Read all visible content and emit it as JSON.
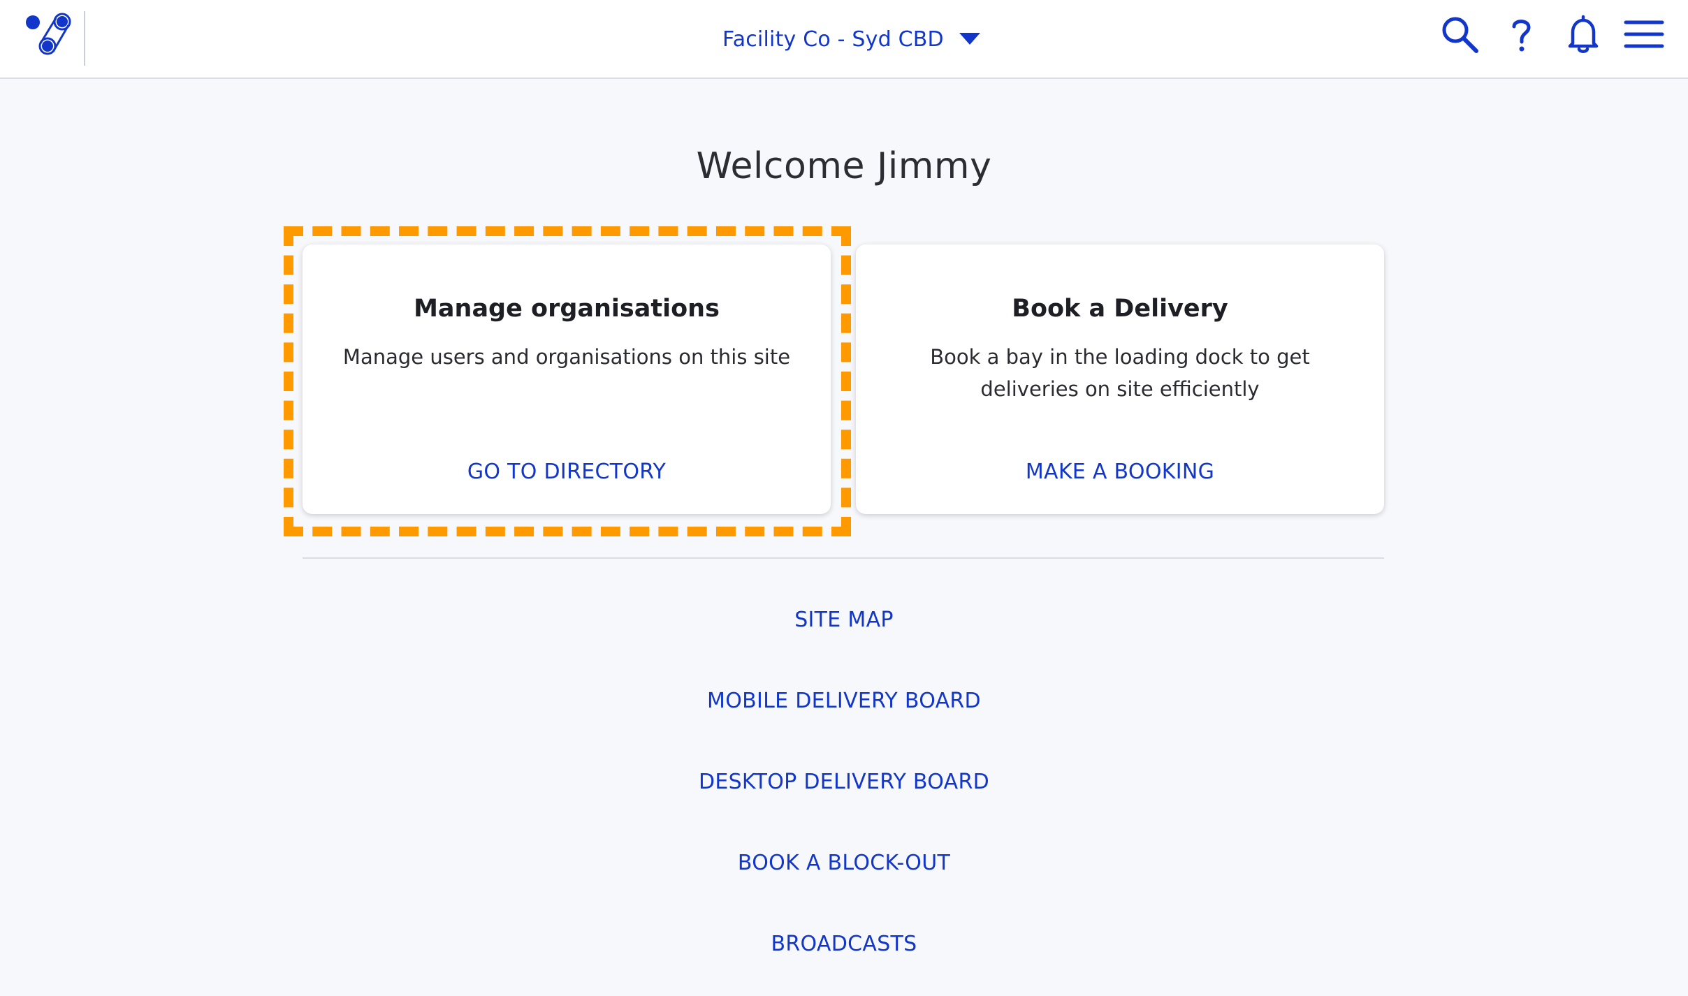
{
  "header": {
    "site_name": "Facility Co - Syd CBD",
    "brand_color": "#1136c9",
    "icons": [
      "logo-icon",
      "search-icon",
      "help-icon",
      "bell-icon",
      "menu-icon"
    ]
  },
  "welcome": "Welcome Jimmy",
  "cards": [
    {
      "title": "Manage organisations",
      "description": "Manage users and organisations on this site",
      "action": "GO TO DIRECTORY"
    },
    {
      "title": "Book a Delivery",
      "description": "Book a bay in the loading dock to get deliveries on site efficiently",
      "action": "MAKE A BOOKING"
    }
  ],
  "links": [
    "SITE MAP",
    "MOBILE DELIVERY BOARD",
    "DESKTOP DELIVERY BOARD",
    "BOOK A BLOCK-OUT",
    "BROADCASTS"
  ],
  "highlight_color": "#ff9900"
}
